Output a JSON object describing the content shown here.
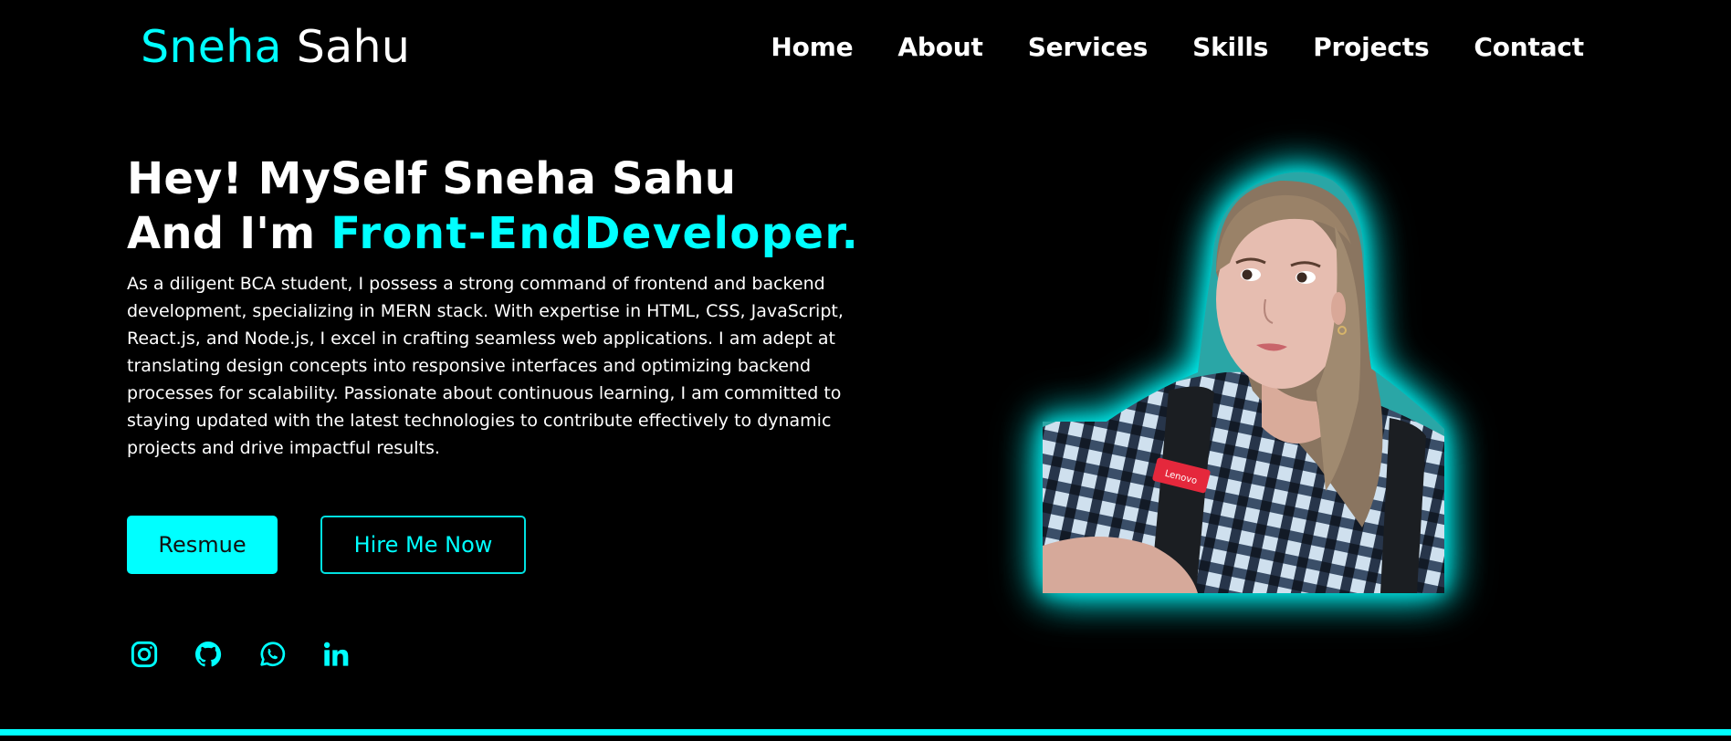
{
  "header": {
    "logo_first": "Sneha",
    "logo_last": "Sahu",
    "nav": [
      {
        "label": "Home"
      },
      {
        "label": "About"
      },
      {
        "label": "Services"
      },
      {
        "label": "Skills"
      },
      {
        "label": "Projects"
      },
      {
        "label": "Contact"
      }
    ]
  },
  "hero": {
    "line1": "Hey! MySelf Sneha Sahu",
    "line2_prefix": "And I'm",
    "role": "Front-EndDeveloper.",
    "description": "As a diligent BCA student, I possess a strong command of frontend and backend development, specializing in MERN stack. With expertise in HTML, CSS, JavaScript, React.js, and Node.js, I excel in crafting seamless web applications. I am adept at translating design concepts into responsive interfaces and optimizing backend processes for scalability. Passionate about continuous learning, I am committed to staying updated with the latest technologies to contribute effectively to dynamic projects and drive impactful results."
  },
  "buttons": {
    "resume_label": "Resmue",
    "hire_label": "Hire Me Now"
  },
  "socials": [
    {
      "icon": "instagram-icon"
    },
    {
      "icon": "github-icon"
    },
    {
      "icon": "whatsapp-icon"
    },
    {
      "icon": "linkedin-icon"
    }
  ],
  "portrait": {
    "badge_text": "Lenovo"
  },
  "colors": {
    "accent": "#00ffff",
    "background": "#000000",
    "text": "#ffffff"
  }
}
